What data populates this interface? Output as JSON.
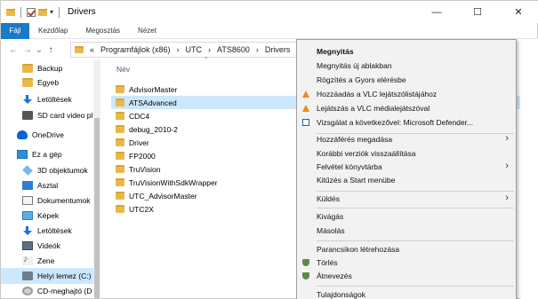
{
  "window": {
    "title": "Drivers",
    "controls": [
      "—",
      "☐",
      "✕"
    ]
  },
  "ribbon": {
    "tabs": [
      "Fájl",
      "Kezdőlap",
      "Megosztás",
      "Nézet"
    ]
  },
  "nav": {
    "back": "←",
    "forward": "→",
    "history": "⌄",
    "up": "↑",
    "breadcrumb": [
      "«",
      "Programfájlok (x86)",
      "›",
      "UTC",
      "›",
      "ATS8600",
      "›",
      "Drivers"
    ]
  },
  "sidebar": {
    "items": [
      {
        "label": "Backup",
        "icon": "folder-icon"
      },
      {
        "label": "Egyeb",
        "icon": "folder-icon"
      },
      {
        "label": "Letöltések",
        "icon": "download-icon"
      },
      {
        "label": "SD card video pl",
        "icon": "sd-card-icon"
      },
      {
        "label": "OneDrive",
        "icon": "onedrive-icon"
      },
      {
        "label": "Ez a gép",
        "icon": "this-pc-icon"
      },
      {
        "label": "3D objektumok",
        "icon": "3d-objects-icon"
      },
      {
        "label": "Asztal",
        "icon": "desktop-icon"
      },
      {
        "label": "Dokumentumok",
        "icon": "documents-icon"
      },
      {
        "label": "Képek",
        "icon": "pictures-icon"
      },
      {
        "label": "Letöltések",
        "icon": "download-icon"
      },
      {
        "label": "Videók",
        "icon": "videos-icon"
      },
      {
        "label": "Zene",
        "icon": "music-icon"
      },
      {
        "label": "Helyi lemez (C:)",
        "icon": "local-disk-icon"
      },
      {
        "label": "CD-meghajtó (D",
        "icon": "cd-drive-icon"
      }
    ]
  },
  "filelist": {
    "column_name": "Név",
    "sort_indicator": "^",
    "rows": [
      "AdvisorMaster",
      "ATSAdvanced",
      "CDC4",
      "debug_2010-2",
      "Driver",
      "FP2000",
      "TruVision",
      "TruVisionWithSdkWrapper",
      "UTC_AdvisorMaster",
      "UTC2X"
    ],
    "selected_index": 1
  },
  "context_menu": {
    "items": [
      {
        "label": "Megnyitás",
        "bold": true
      },
      {
        "label": "Megnyitás új ablakban"
      },
      {
        "label": "Rögzítés a Gyors elérésbe"
      },
      {
        "label": "Hozzáadás a VLC lejátszólistájához",
        "icon": "vlc-icon"
      },
      {
        "label": "Lejátszás a VLC médialejátszóval",
        "icon": "vlc-icon"
      },
      {
        "label": "Vizsgálat a következővel: Microsoft Defender...",
        "icon": "defender-icon"
      },
      {
        "label": "Hozzáférés megadása",
        "submenu": true
      },
      {
        "label": "Korábbi verziók visszaállítása"
      },
      {
        "label": "Felvétel könyvtárba",
        "submenu": true
      },
      {
        "label": "Kitűzés a Start menübe"
      },
      {
        "label": "Küldés",
        "submenu": true
      },
      {
        "label": "Kivágás"
      },
      {
        "label": "Másolás"
      },
      {
        "label": "Parancsikon létrehozása"
      },
      {
        "label": "Törlés",
        "icon": "shield-icon"
      },
      {
        "label": "Átnevezés",
        "icon": "shield-icon"
      },
      {
        "label": "Tulajdonságok"
      }
    ],
    "submenu_arrow": "›"
  },
  "colors": {
    "accent": "#1979ca",
    "selection": "#cce8ff",
    "folder": "#e8b84a",
    "vlc": "#f08a18"
  }
}
